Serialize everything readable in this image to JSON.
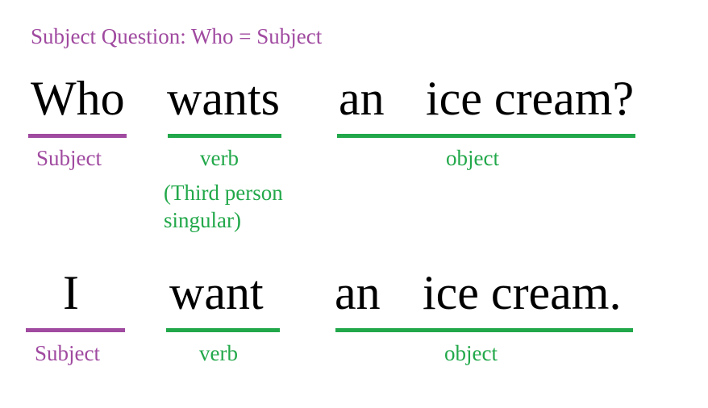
{
  "title": "Subject Question: Who = Subject",
  "colors": {
    "subject": "#a04aa0",
    "other": "#22a84a",
    "text": "#000000",
    "background": "#ffffff"
  },
  "question": {
    "words": [
      "Who",
      "wants",
      "an",
      "ice cream?"
    ],
    "labels": {
      "subject": "Subject",
      "verb": "verb",
      "object": "object"
    },
    "verb_note": [
      "(Third person",
      "singular)"
    ]
  },
  "answer": {
    "words": [
      "I",
      "want",
      "an",
      "ice cream."
    ],
    "labels": {
      "subject": "Subject",
      "verb": "verb",
      "object": "object"
    }
  }
}
